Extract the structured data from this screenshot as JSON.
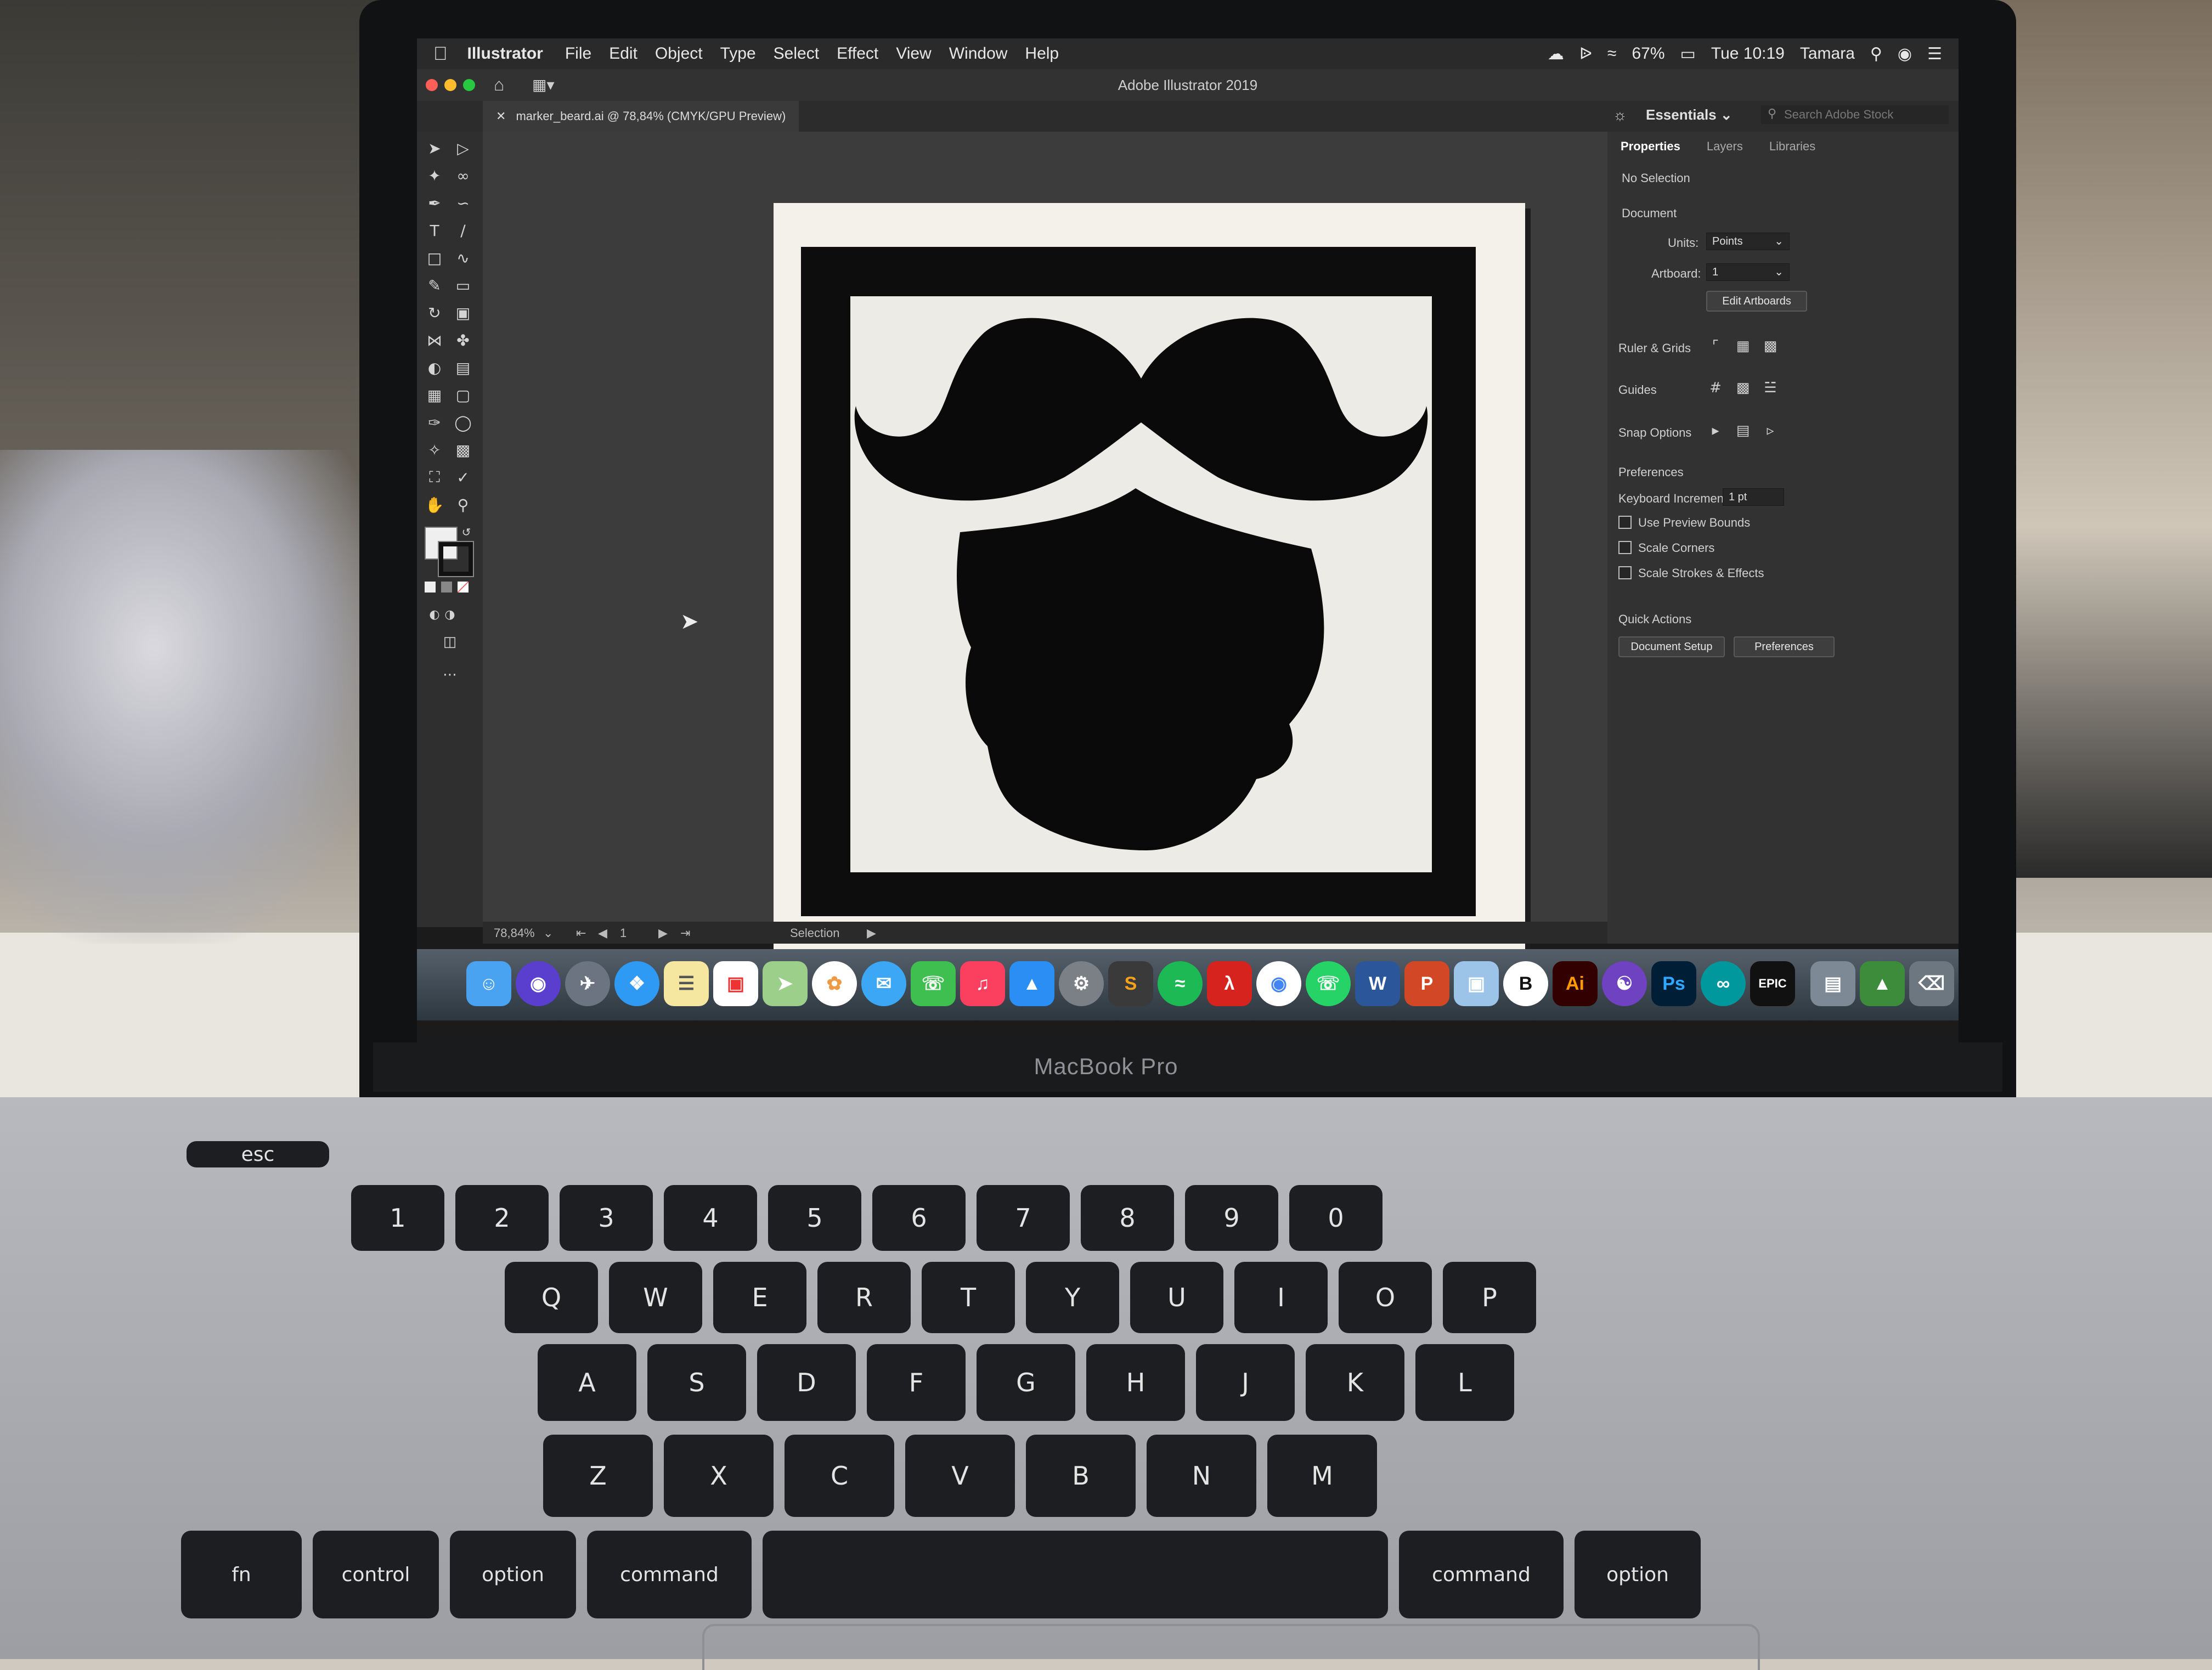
{
  "menubar": {
    "app_name": "Illustrator",
    "menus": [
      "File",
      "Edit",
      "Object",
      "Type",
      "Select",
      "Effect",
      "View",
      "Window",
      "Help"
    ],
    "battery": "67%",
    "clock": "Tue 10:19",
    "user": "Tamara"
  },
  "window": {
    "title": "Adobe Illustrator 2019",
    "document_tab": "marker_beard.ai @ 78,84% (CMYK/GPU Preview)",
    "workspace": "Essentials",
    "stock_search_placeholder": "Search Adobe Stock"
  },
  "statusbar": {
    "zoom": "78,84%",
    "artboard": "1",
    "tool": "Selection"
  },
  "properties_panel": {
    "tabs": [
      "Properties",
      "Layers",
      "Libraries"
    ],
    "selection": "No Selection",
    "document_heading": "Document",
    "units_label": "Units:",
    "units_value": "Points",
    "artboard_label": "Artboard:",
    "artboard_value": "1",
    "edit_artboards": "Edit Artboards",
    "ruler_grids": "Ruler & Grids",
    "guides": "Guides",
    "snap_options": "Snap Options",
    "preferences_heading": "Preferences",
    "keyboard_increment_label": "Keyboard Increment:",
    "keyboard_increment_value": "1 pt",
    "checkboxes": [
      "Use Preview Bounds",
      "Scale Corners",
      "Scale Strokes & Effects"
    ],
    "quick_actions": "Quick Actions",
    "document_setup": "Document Setup",
    "preferences_button": "Preferences"
  },
  "dock": {
    "labels": {
      "illustrator": "Ai",
      "photoshop": "Ps",
      "epic": "EPIC"
    }
  },
  "hardware": {
    "brand": "MacBook Pro",
    "keys": {
      "esc": "esc",
      "row_num": [
        "1",
        "2",
        "3",
        "4",
        "5",
        "6",
        "7",
        "8",
        "9",
        "0"
      ],
      "row_q": [
        "Q",
        "W",
        "E",
        "R",
        "T",
        "Y",
        "U",
        "I",
        "O",
        "P"
      ],
      "row_a": [
        "A",
        "S",
        "D",
        "F",
        "G",
        "H",
        "J",
        "K",
        "L"
      ],
      "row_z": [
        "Z",
        "X",
        "C",
        "V",
        "B",
        "N",
        "M"
      ],
      "fn": "fn",
      "control": "control",
      "option": "option",
      "command": "command"
    }
  },
  "colors": {
    "ui_dark": "#323232",
    "artboard": "#f3f1ea",
    "artwork": "#0d0d0d",
    "illustrator_orange": "#ff9a00",
    "photoshop_blue": "#31a8ff"
  }
}
